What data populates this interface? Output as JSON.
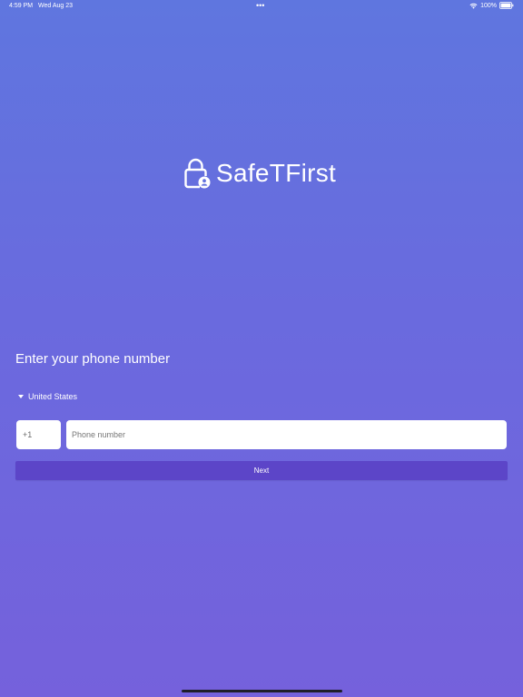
{
  "status_bar": {
    "time": "4:59 PM",
    "date": "Wed Aug 23",
    "dots": "•••",
    "battery": "100%"
  },
  "app": {
    "name": "SafeTFirst"
  },
  "login": {
    "heading": "Enter your phone number",
    "country": "United States",
    "country_code": "+1",
    "phone_placeholder": "Phone number",
    "phone_value": "",
    "next_label": "Next"
  },
  "icons": {
    "logo": "lock-user-icon",
    "country_toggle": "caret-down-icon",
    "wifi": "wifi-icon",
    "battery": "battery-icon"
  },
  "colors": {
    "background_top": "#5f76df",
    "background_bottom": "#7561dc",
    "button": "#5c45c8",
    "text": "#ffffff"
  }
}
